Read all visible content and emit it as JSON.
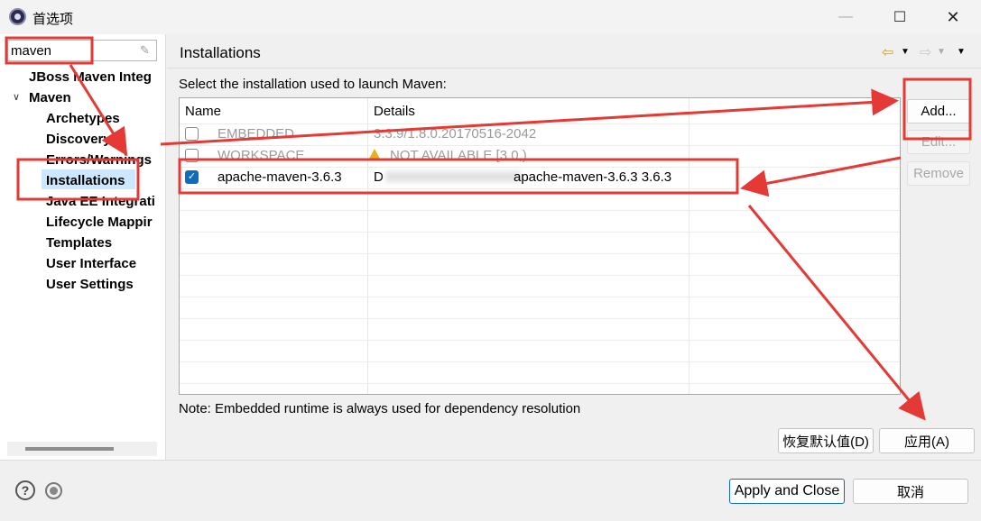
{
  "window": {
    "title": "首选项"
  },
  "filter": {
    "value": "maven"
  },
  "tree": {
    "items": [
      {
        "label": "JBoss Maven Integ",
        "level": 1
      },
      {
        "label": "Maven",
        "level": 1
      },
      {
        "label": "Archetypes",
        "level": 2
      },
      {
        "label": "Discovery",
        "level": 2
      },
      {
        "label": "Errors/Warnings",
        "level": 2
      },
      {
        "label": "Installations",
        "level": 2,
        "selected": true
      },
      {
        "label": "Java EE Integrati",
        "level": 2
      },
      {
        "label": "Lifecycle Mappir",
        "level": 2
      },
      {
        "label": "Templates",
        "level": 2
      },
      {
        "label": "User Interface",
        "level": 2
      },
      {
        "label": "User Settings",
        "level": 2
      }
    ]
  },
  "page": {
    "title": "Installations",
    "instruction": "Select the installation used to launch Maven:",
    "note": "Note: Embedded runtime is always used for dependency resolution"
  },
  "table": {
    "headers": [
      "Name",
      "Details"
    ],
    "rows": [
      {
        "name": "EMBEDDED",
        "details": "3.3.9/1.8.0.20170516-2042",
        "checked": false,
        "disabled": true
      },
      {
        "name": "WORKSPACE",
        "details": "NOT AVAILABLE [3.0,)",
        "checked": false,
        "disabled": true,
        "warning": true
      },
      {
        "name": "apache-maven-3.6.3",
        "details_prefix": "D",
        "details": "apache-maven-3.6.3 3.6.3",
        "checked": true,
        "disabled": false
      }
    ]
  },
  "buttons": {
    "add": "Add...",
    "edit": "Edit...",
    "remove": "Remove",
    "restore_defaults": "恢复默认值(D)",
    "apply": "应用(A)",
    "apply_and_close": "Apply and Close",
    "cancel": "取消"
  },
  "colors": {
    "annotation": "#e53935",
    "selection": "#cce8ff",
    "checkbox": "#0f6cbd"
  }
}
